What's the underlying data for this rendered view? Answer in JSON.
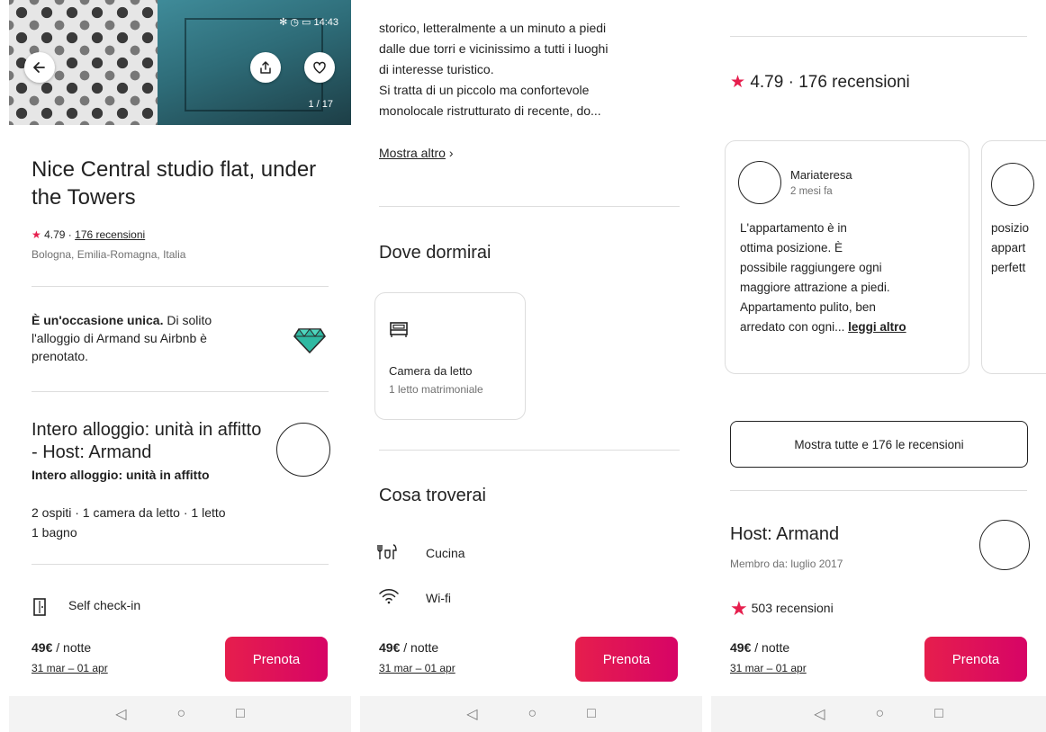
{
  "common": {
    "price": "49€",
    "per_night": " / notte",
    "dates": "31 mar – 01 apr",
    "book_label": "Prenota",
    "nav": {
      "back": "◁",
      "home": "○",
      "recents": "□"
    }
  },
  "screen1": {
    "status_time": "14:43",
    "status_icons": "✻ ◷ ▭",
    "photo_counter": "1 / 17",
    "title": "Nice Central studio flat, under the Towers",
    "rating": "4.79",
    "rating_sep": " · ",
    "reviews_link": "176 recensioni",
    "location": "Bologna, Emilia-Romagna, Italia",
    "rare_bold": "È un'occasione unica.",
    "rare_text": " Di solito l'alloggio di Armand su Airbnb è prenotato.",
    "host_heading": "Intero alloggio: unità in affitto - Host: Armand",
    "host_sub": "Intero alloggio: unità in affitto",
    "capacity_line1": "2 ospiti · 1 camera da letto · 1 letto",
    "capacity_line2": "1 bagno",
    "checkin": "Self check-in"
  },
  "screen2": {
    "desc_lines": [
      "storico, letteralmente a un minuto a piedi",
      "dalle due torri e vicinissimo a tutti i luoghi",
      "di interesse turistico.",
      "Si tratta di un piccolo ma confortevole",
      "monolocale ristrutturato di recente, do..."
    ],
    "show_more": "Mostra altro",
    "sleep_heading": "Dove dormirai",
    "room_title": "Camera da letto",
    "room_sub": "1 letto matrimoniale",
    "amenities_heading": "Cosa troverai",
    "amenities": [
      "Cucina",
      "Wi-fi"
    ]
  },
  "screen3": {
    "rating_summary": "4.79 · 176 recensioni",
    "review_name": "Mariateresa",
    "review_time": "2 mesi fa",
    "review_lines": [
      "L'appartamento è in",
      "ottima posizione. È",
      "possibile raggiungere ogni",
      "maggiore attrazione a piedi.",
      "Appartamento pulito, ben",
      "arredato con ogni..."
    ],
    "read_more": "leggi altro",
    "peek_lines": [
      "posizio",
      "appart",
      "perfett"
    ],
    "show_all_reviews": "Mostra tutte e 176 le recensioni",
    "host_title": "Host: Armand",
    "member_since": "Membro da: luglio 2017",
    "host_reviews": "503 recensioni"
  }
}
